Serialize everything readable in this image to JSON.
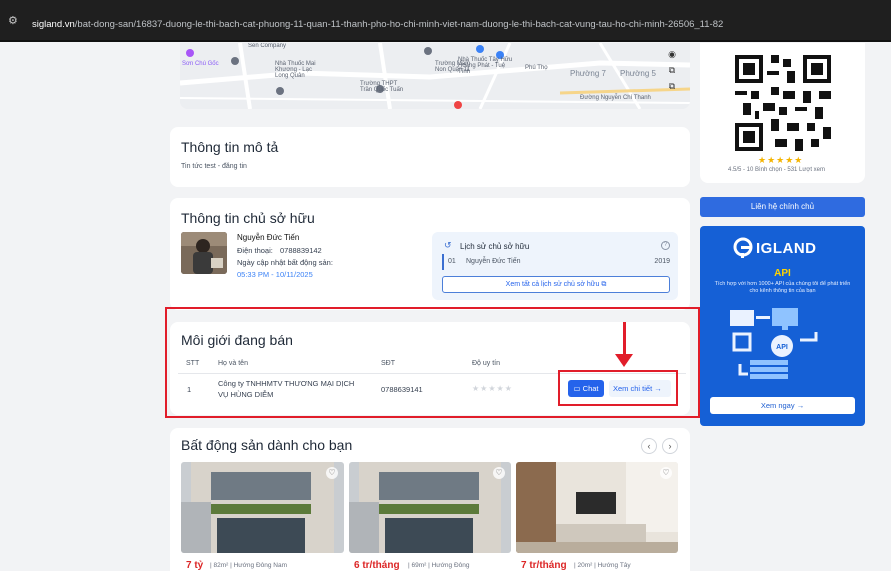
{
  "browser": {
    "domain": "sigland.vn",
    "path": "/bat-dong-san/16837-duong-le-thi-bach-cat-phuong-11-quan-11-thanh-pho-ho-chi-minh-viet-nam-duong-le-thi-bach-cat-vung-tau-ho-chi-minh-26506_11-82"
  },
  "map": {
    "labels": [
      "Sen Company",
      "Sơn Chú Gốc",
      "Nhà Thuốc Mai Khương - Lạc Long Quân",
      "Trường THPT Trần Quốc Tuấn",
      "Trường Mầm Non Quận 11",
      "Nhà Thuốc Tây Hữu Hoàng Phát - Tuệ Tĩnh",
      "Phú Thọ",
      "Phường 7",
      "Phường 5",
      "Đường Nguyễn Chí Thanh"
    ]
  },
  "description": {
    "title": "Thông tin mô tả",
    "text": "Tin tức test - đăng tin"
  },
  "owner": {
    "title": "Thông tin chủ sở hữu",
    "name": "Nguyễn Đức Tiến",
    "phone_label": "Điện thoại:",
    "phone": "0788839142",
    "update_label": "Ngày cập nhật bất động sản:",
    "update_time": "05:33 PM - 10/11/2025",
    "history": {
      "title": "Lịch sử chủ sở hữu",
      "index": "01",
      "name": "Nguyễn Đức Tiến",
      "year": "2019",
      "view_all": "Xem tất cả lịch sử chủ sở hữu"
    }
  },
  "broker": {
    "title": "Môi giới đang bán",
    "columns": [
      "STT",
      "Họ và tên",
      "SĐT",
      "Độ uy tín"
    ],
    "rows": [
      {
        "stt": "1",
        "name_line1": "Công ty TNHHMTV THƯƠNG MẠI DỊCH",
        "name_line2": "VỤ HÙNG DIỄM",
        "phone": "0788639141"
      }
    ],
    "chat_label": "Chat",
    "detail_label": "Xem chi tiết"
  },
  "recommendations": {
    "title": "Bất động sản dành cho bạn",
    "items": [
      {
        "price": "7 tỷ",
        "meta": "| 82m² | Hướng Đông Nam"
      },
      {
        "price": "6 tr/tháng",
        "meta": "| 69m² | Hướng Đông"
      },
      {
        "price": "7 tr/tháng",
        "meta": "| 20m² | Hướng Tây"
      }
    ]
  },
  "sidebar": {
    "rating_text": "4.5/5 - 10 Bình chọn - 531 Lượt xem",
    "contact_button": "Liên hệ chính chủ",
    "promo": {
      "brand": "IGLAND",
      "api": "API",
      "tagline": "Tích hợp với hơn 1000+ API của chúng tôi để phát triển cho kênh thông tin của bạn",
      "cta": "Xem ngay"
    }
  },
  "colors": {
    "accent": "#2563eb",
    "annotation": "#e11d2a",
    "price": "#dc2626",
    "promo_bg": "#1560d6"
  }
}
